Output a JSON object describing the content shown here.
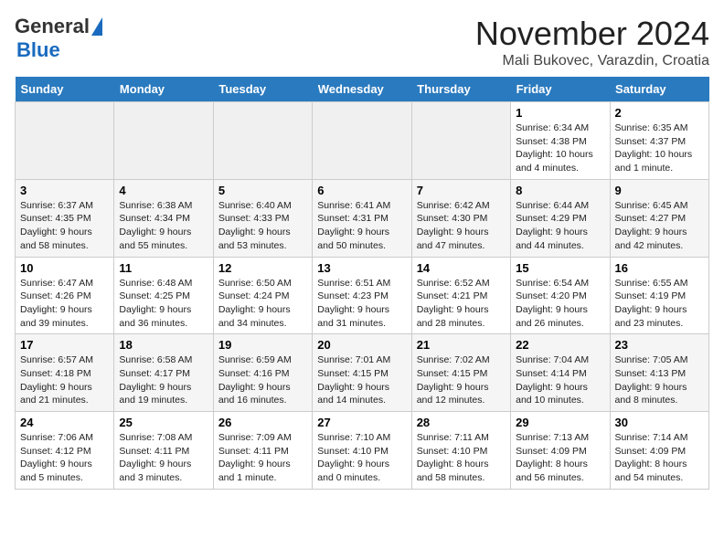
{
  "header": {
    "logo_general": "General",
    "logo_blue": "Blue",
    "month_title": "November 2024",
    "location": "Mali Bukovec, Varazdin, Croatia"
  },
  "weekdays": [
    "Sunday",
    "Monday",
    "Tuesday",
    "Wednesday",
    "Thursday",
    "Friday",
    "Saturday"
  ],
  "weeks": [
    [
      {
        "day": "",
        "empty": true
      },
      {
        "day": "",
        "empty": true
      },
      {
        "day": "",
        "empty": true
      },
      {
        "day": "",
        "empty": true
      },
      {
        "day": "",
        "empty": true
      },
      {
        "day": "1",
        "sunrise": "Sunrise: 6:34 AM",
        "sunset": "Sunset: 4:38 PM",
        "daylight": "Daylight: 10 hours and 4 minutes."
      },
      {
        "day": "2",
        "sunrise": "Sunrise: 6:35 AM",
        "sunset": "Sunset: 4:37 PM",
        "daylight": "Daylight: 10 hours and 1 minute."
      }
    ],
    [
      {
        "day": "3",
        "sunrise": "Sunrise: 6:37 AM",
        "sunset": "Sunset: 4:35 PM",
        "daylight": "Daylight: 9 hours and 58 minutes."
      },
      {
        "day": "4",
        "sunrise": "Sunrise: 6:38 AM",
        "sunset": "Sunset: 4:34 PM",
        "daylight": "Daylight: 9 hours and 55 minutes."
      },
      {
        "day": "5",
        "sunrise": "Sunrise: 6:40 AM",
        "sunset": "Sunset: 4:33 PM",
        "daylight": "Daylight: 9 hours and 53 minutes."
      },
      {
        "day": "6",
        "sunrise": "Sunrise: 6:41 AM",
        "sunset": "Sunset: 4:31 PM",
        "daylight": "Daylight: 9 hours and 50 minutes."
      },
      {
        "day": "7",
        "sunrise": "Sunrise: 6:42 AM",
        "sunset": "Sunset: 4:30 PM",
        "daylight": "Daylight: 9 hours and 47 minutes."
      },
      {
        "day": "8",
        "sunrise": "Sunrise: 6:44 AM",
        "sunset": "Sunset: 4:29 PM",
        "daylight": "Daylight: 9 hours and 44 minutes."
      },
      {
        "day": "9",
        "sunrise": "Sunrise: 6:45 AM",
        "sunset": "Sunset: 4:27 PM",
        "daylight": "Daylight: 9 hours and 42 minutes."
      }
    ],
    [
      {
        "day": "10",
        "sunrise": "Sunrise: 6:47 AM",
        "sunset": "Sunset: 4:26 PM",
        "daylight": "Daylight: 9 hours and 39 minutes."
      },
      {
        "day": "11",
        "sunrise": "Sunrise: 6:48 AM",
        "sunset": "Sunset: 4:25 PM",
        "daylight": "Daylight: 9 hours and 36 minutes."
      },
      {
        "day": "12",
        "sunrise": "Sunrise: 6:50 AM",
        "sunset": "Sunset: 4:24 PM",
        "daylight": "Daylight: 9 hours and 34 minutes."
      },
      {
        "day": "13",
        "sunrise": "Sunrise: 6:51 AM",
        "sunset": "Sunset: 4:23 PM",
        "daylight": "Daylight: 9 hours and 31 minutes."
      },
      {
        "day": "14",
        "sunrise": "Sunrise: 6:52 AM",
        "sunset": "Sunset: 4:21 PM",
        "daylight": "Daylight: 9 hours and 28 minutes."
      },
      {
        "day": "15",
        "sunrise": "Sunrise: 6:54 AM",
        "sunset": "Sunset: 4:20 PM",
        "daylight": "Daylight: 9 hours and 26 minutes."
      },
      {
        "day": "16",
        "sunrise": "Sunrise: 6:55 AM",
        "sunset": "Sunset: 4:19 PM",
        "daylight": "Daylight: 9 hours and 23 minutes."
      }
    ],
    [
      {
        "day": "17",
        "sunrise": "Sunrise: 6:57 AM",
        "sunset": "Sunset: 4:18 PM",
        "daylight": "Daylight: 9 hours and 21 minutes."
      },
      {
        "day": "18",
        "sunrise": "Sunrise: 6:58 AM",
        "sunset": "Sunset: 4:17 PM",
        "daylight": "Daylight: 9 hours and 19 minutes."
      },
      {
        "day": "19",
        "sunrise": "Sunrise: 6:59 AM",
        "sunset": "Sunset: 4:16 PM",
        "daylight": "Daylight: 9 hours and 16 minutes."
      },
      {
        "day": "20",
        "sunrise": "Sunrise: 7:01 AM",
        "sunset": "Sunset: 4:15 PM",
        "daylight": "Daylight: 9 hours and 14 minutes."
      },
      {
        "day": "21",
        "sunrise": "Sunrise: 7:02 AM",
        "sunset": "Sunset: 4:15 PM",
        "daylight": "Daylight: 9 hours and 12 minutes."
      },
      {
        "day": "22",
        "sunrise": "Sunrise: 7:04 AM",
        "sunset": "Sunset: 4:14 PM",
        "daylight": "Daylight: 9 hours and 10 minutes."
      },
      {
        "day": "23",
        "sunrise": "Sunrise: 7:05 AM",
        "sunset": "Sunset: 4:13 PM",
        "daylight": "Daylight: 9 hours and 8 minutes."
      }
    ],
    [
      {
        "day": "24",
        "sunrise": "Sunrise: 7:06 AM",
        "sunset": "Sunset: 4:12 PM",
        "daylight": "Daylight: 9 hours and 5 minutes."
      },
      {
        "day": "25",
        "sunrise": "Sunrise: 7:08 AM",
        "sunset": "Sunset: 4:11 PM",
        "daylight": "Daylight: 9 hours and 3 minutes."
      },
      {
        "day": "26",
        "sunrise": "Sunrise: 7:09 AM",
        "sunset": "Sunset: 4:11 PM",
        "daylight": "Daylight: 9 hours and 1 minute."
      },
      {
        "day": "27",
        "sunrise": "Sunrise: 7:10 AM",
        "sunset": "Sunset: 4:10 PM",
        "daylight": "Daylight: 9 hours and 0 minutes."
      },
      {
        "day": "28",
        "sunrise": "Sunrise: 7:11 AM",
        "sunset": "Sunset: 4:10 PM",
        "daylight": "Daylight: 8 hours and 58 minutes."
      },
      {
        "day": "29",
        "sunrise": "Sunrise: 7:13 AM",
        "sunset": "Sunset: 4:09 PM",
        "daylight": "Daylight: 8 hours and 56 minutes."
      },
      {
        "day": "30",
        "sunrise": "Sunrise: 7:14 AM",
        "sunset": "Sunset: 4:09 PM",
        "daylight": "Daylight: 8 hours and 54 minutes."
      }
    ]
  ]
}
